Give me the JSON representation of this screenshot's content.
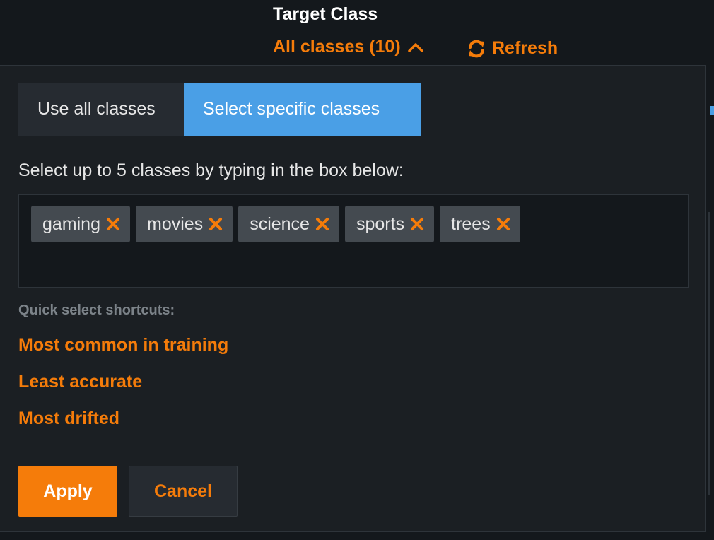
{
  "header": {
    "target_label": "Target Class",
    "dropdown_label": "All classes (10)",
    "dropdown_icon": "chevron-up-icon",
    "refresh_label": "Refresh",
    "refresh_icon": "refresh-icon"
  },
  "panel": {
    "modes": [
      {
        "label": "Use all classes",
        "selected": false
      },
      {
        "label": "Select specific classes",
        "selected": true
      }
    ],
    "instruction": "Select up to 5 classes by typing in the box below:",
    "selected_classes": [
      "gaming",
      "movies",
      "science",
      "sports",
      "trees"
    ],
    "remove_icon": "close-icon",
    "shortcuts_label": "Quick select shortcuts:",
    "shortcuts": [
      "Most common in training",
      "Least accurate",
      "Most drifted"
    ],
    "apply_label": "Apply",
    "cancel_label": "Cancel"
  },
  "colors": {
    "accent": "#f57c0a",
    "selected_mode": "#4a9fe6",
    "background": "#14181c",
    "panel": "#1b1f23",
    "tag": "#444a50"
  }
}
